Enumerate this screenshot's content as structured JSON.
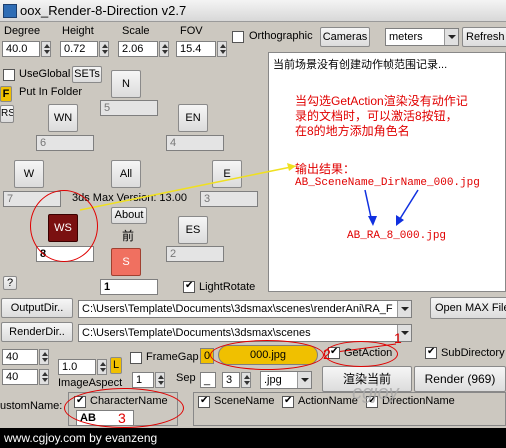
{
  "title": "oox_Render-8-Direction v2.7",
  "header": {
    "degree_label": "Degree",
    "height_label": "Height",
    "scale_label": "Scale",
    "fov_label": "FOV",
    "degree_value": "40.0",
    "height_value": "0.72",
    "scale_value": "2.06",
    "fov_value": "15.4",
    "ortho_label": "Orthographic",
    "cameras_label": "Cameras",
    "units_value": "meters",
    "refresh_label": "Refresh"
  },
  "left": {
    "useglobal_label": "UseGlobal",
    "sets_label": "SETs",
    "put_in_folder": "Put In Folder",
    "f_label": "F",
    "rs_label": "RS"
  },
  "dirs": {
    "n": "N",
    "n_val": "5",
    "wn": "WN",
    "wn_val": "6",
    "en": "EN",
    "en_val": "4",
    "w": "W",
    "w_val": "7",
    "all": "All",
    "e": "E",
    "e_val": "3",
    "ws": "WS",
    "ws_val": "8",
    "about": "About",
    "front": "前",
    "es": "ES",
    "es_val": "2",
    "s": "S",
    "s_val": "1",
    "version": "3ds Max Version: 13.00"
  },
  "light_rotate": "LightRotate",
  "help_label": "?",
  "message": {
    "line1": "当前场景没有创建动作帧范围记录...",
    "red1": "当勾选GetAction渲染没有动作记",
    "red2": "录的文档时，可以激活8按钮，",
    "red3": "在8的地方添加角色名",
    "out_label": "输出结果：",
    "out1": "AB_SceneName_DirName_000.jpg",
    "out2": "AB_RA_8_000.jpg"
  },
  "paths": {
    "output_btn": "OutputDir..",
    "output_value": "C:\\Users\\Template\\Documents\\3dsmax\\scenes\\renderAni\\RA_F",
    "render_btn": "RenderDir..",
    "render_value": "C:\\Users\\Template\\Documents\\3dsmax\\scenes",
    "open_max": "Open MAX File"
  },
  "bottom": {
    "w_val": "40",
    "h_val": "40",
    "aspect_val": "1.0",
    "l_label": "L",
    "image_aspect": "ImageAspect",
    "framegap_label": "FrameGap",
    "framegap_val": "0",
    "filename_val": "000.jpg",
    "sep_label": "Sep",
    "sep_val": "_",
    "digits_val": "3",
    "ext_val": ".jpg",
    "one_val": "1",
    "getaction_label": "GetAction",
    "subdirectory_label": "SubDirectory",
    "render_current": "渲染当前",
    "render_btn": "Render (969)",
    "customname_label": "ustomName:",
    "charactername_label": "CharacterName",
    "charactername_val": "AB",
    "scenename_label": "SceneName",
    "actionname_label": "ActionName",
    "directionname_label": "DirectionName"
  },
  "annotations": {
    "n1": "1",
    "n2": "2",
    "n3": "3"
  },
  "footer": "www.cgjoy.com by evanzeng",
  "watermark": "cgjoy"
}
